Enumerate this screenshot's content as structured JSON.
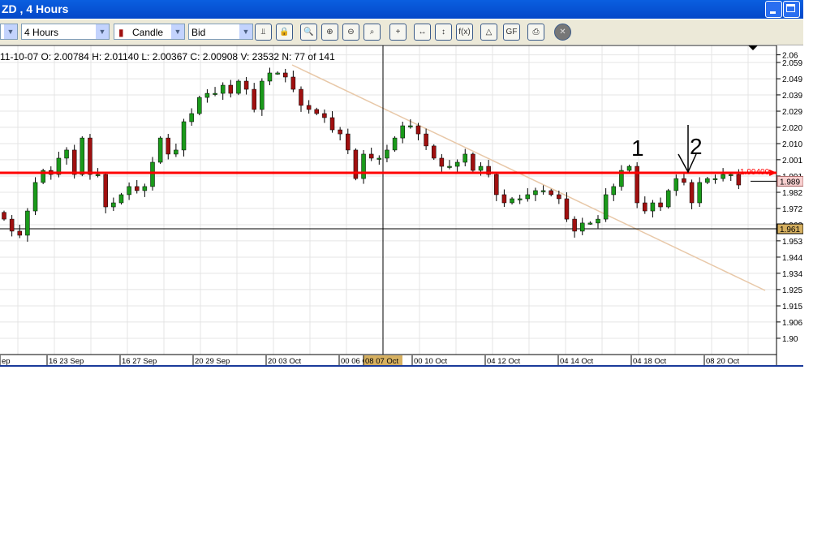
{
  "window": {
    "title": "ZD , 4 Hours"
  },
  "toolbar": {
    "period": "4 Hours",
    "chart_type": "Candle",
    "price_type": "Bid",
    "buttons": [
      "bar-chart-icon",
      "lock-icon",
      "zoom-fit-icon",
      "zoom-in-icon",
      "zoom-out-icon",
      "zoom-area-icon",
      "crosshair-icon",
      "horizontal-scale-icon",
      "vertical-scale-icon",
      "function-icon",
      "shapes-icon",
      "fibonacci-icon",
      "print-icon",
      "close-icon"
    ]
  },
  "info": {
    "text": "11-10-07  O: 2.00784  H: 2.01140  L: 2.00367  C: 2.00908  V: 23532  N: 77 of 141"
  },
  "chart_data": {
    "type": "candlestick",
    "y_ticks": [
      "2.06",
      "2.059",
      "2.049",
      "2.039",
      "2.029",
      "2.020",
      "2.010",
      "2.001",
      "1.991",
      "1.982",
      "1.972",
      "1.963",
      "1.953",
      "1.944",
      "1.934",
      "1.925",
      "1.915",
      "1.906",
      "1.90"
    ],
    "y_tick_values": [
      2.0635,
      2.059,
      2.0494,
      2.0399,
      2.0303,
      2.0208,
      2.0112,
      2.0017,
      1.9921,
      1.9825,
      1.973,
      1.9634,
      1.9539,
      1.9443,
      1.9348,
      1.9252,
      1.9156,
      1.9061,
      1.8965
    ],
    "x_labels": [
      "ep",
      "16 23 Sep",
      "16 27 Sep",
      "20 29 Sep",
      "20 03 Oct",
      "00 06 Oct",
      "08 07 Oct",
      "00 10 Oct",
      "04 12 Oct",
      "04 14 Oct",
      "04 18 Oct",
      "08 20 Oct"
    ],
    "closes": [
      1.9667,
      1.9596,
      1.9572,
      1.9715,
      1.9883,
      1.9954,
      1.993,
      2.0026,
      2.0074,
      1.993,
      2.0145,
      1.993,
      1.993,
      1.9739,
      1.9763,
      1.9811,
      1.9859,
      1.9835,
      1.9859,
      2.0002,
      2.0145,
      2.005,
      2.0074,
      2.0241,
      2.0289,
      2.0384,
      2.0408,
      2.0408,
      2.0456,
      2.0408,
      2.048,
      2.0432,
      2.0313,
      2.048,
      2.0528,
      2.0528,
      2.0504,
      2.0432,
      2.0337,
      2.0313,
      2.0289,
      2.0265,
      2.0193,
      2.0169,
      2.0074,
      1.9906,
      2.005,
      2.0026,
      2.0026,
      2.0074,
      2.0145,
      2.0217,
      2.0217,
      2.0169,
      2.0098,
      2.0026,
      1.9978,
      1.9978,
      2.0002,
      2.005,
      1.9954,
      1.9978,
      1.993,
      1.9811,
      1.9763,
      1.9787,
      1.9787,
      1.9811,
      1.9835,
      1.9835,
      1.9811,
      1.9787,
      1.9667,
      1.9596,
      1.9644,
      1.9644,
      1.9667,
      1.9811,
      1.9859,
      1.9954,
      1.9978,
      1.9763,
      1.9715,
      1.9763,
      1.9739,
      1.9835,
      1.9906,
      1.9883,
      1.9763,
      1.9883,
      1.9906,
      1.9906,
      1.993,
      1.993,
      1.9868
    ],
    "resistance": {
      "value": 1.994,
      "label": "1.99400",
      "color": "#ff0000"
    },
    "current_price": {
      "value": 1.989,
      "label": "1.989"
    },
    "crosshair_price": {
      "value": 1.961,
      "label": "1.961"
    },
    "selected_x_label": "08 07 Oct",
    "annotations": [
      "1",
      "2"
    ],
    "colors": {
      "up": "#1a9a1a",
      "down": "#a01010",
      "trend": "#e8c8a8"
    }
  }
}
